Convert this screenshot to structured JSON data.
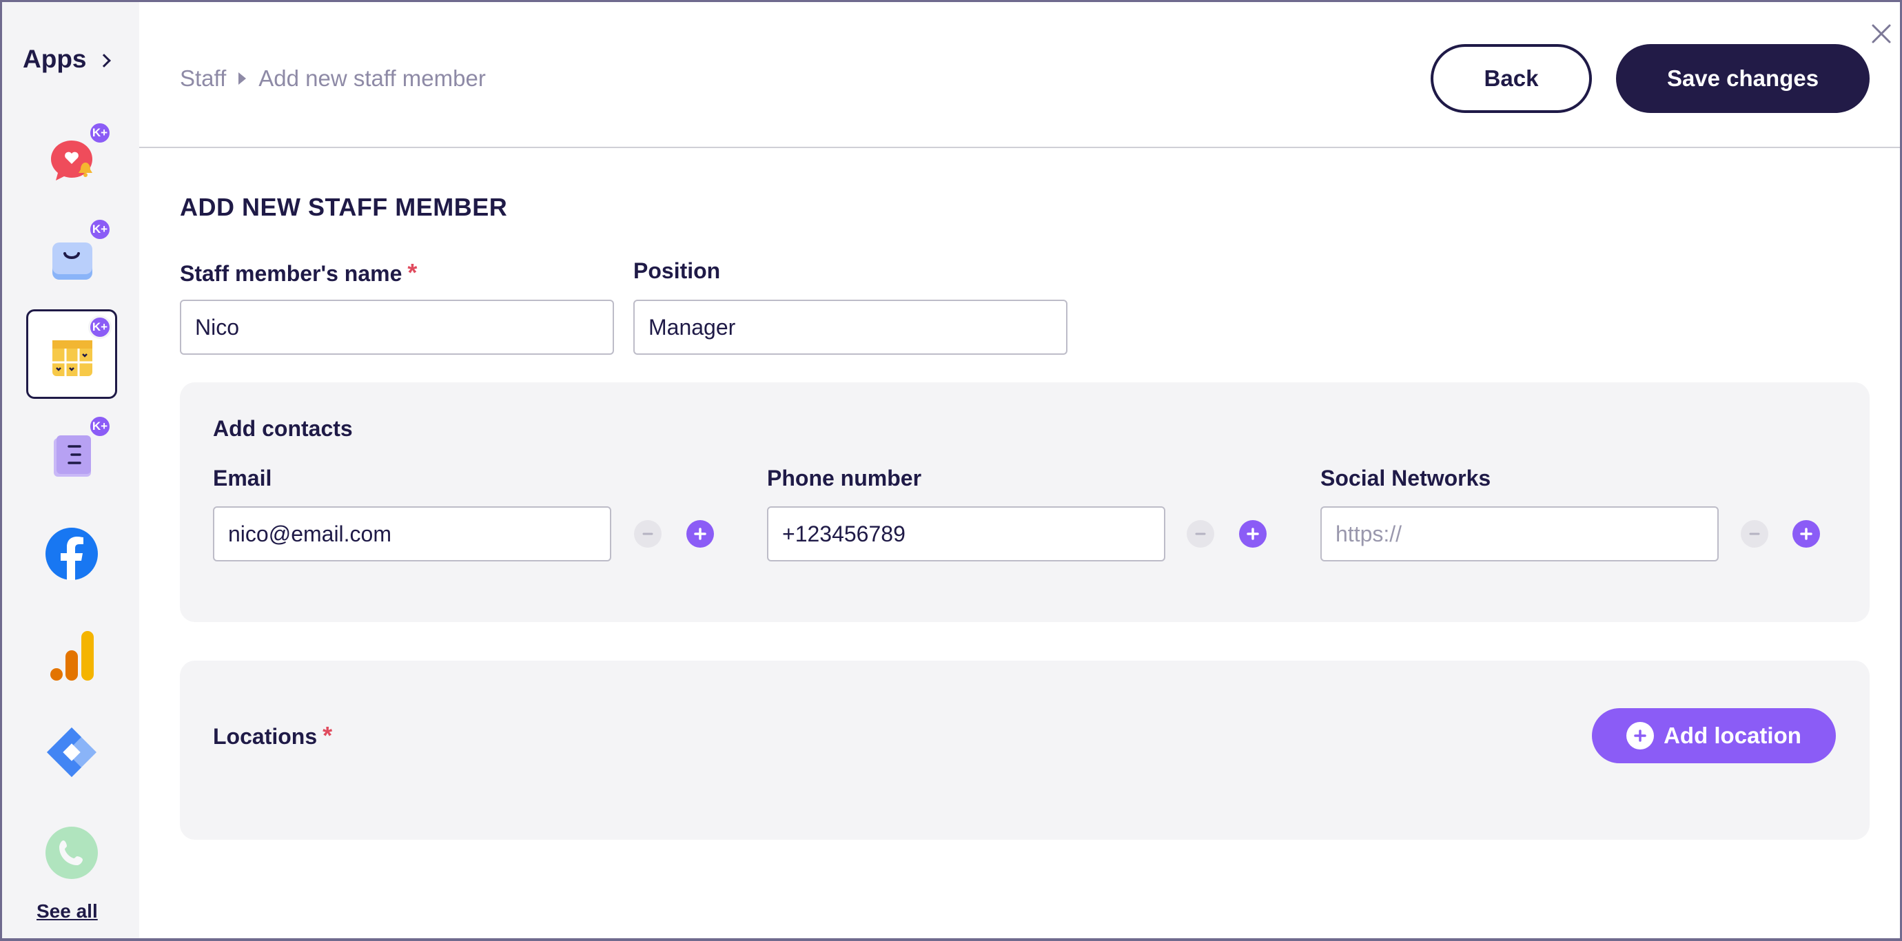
{
  "sidebar": {
    "title": "Apps",
    "items": [
      {
        "icon": "chat-heart-bell-icon",
        "badge": "K+"
      },
      {
        "icon": "shopping-bag-icon",
        "badge": "K+"
      },
      {
        "icon": "calendar-grid-icon",
        "badge": "K+",
        "active": true
      },
      {
        "icon": "document-list-icon",
        "badge": "K+"
      },
      {
        "icon": "facebook-icon"
      },
      {
        "icon": "analytics-bars-icon"
      },
      {
        "icon": "tag-manager-icon"
      },
      {
        "icon": "phone-icon"
      }
    ],
    "see_all": "See all"
  },
  "header": {
    "breadcrumb_root": "Staff",
    "breadcrumb_current": "Add new staff member",
    "back_label": "Back",
    "save_label": "Save changes"
  },
  "form": {
    "title": "ADD NEW STAFF MEMBER",
    "name_label": "Staff member's name",
    "required_mark": "*",
    "name_value": "Nico",
    "position_label": "Position",
    "position_value": "Manager"
  },
  "contacts": {
    "title": "Add contacts",
    "email_label": "Email",
    "email_value": "nico@email.com",
    "phone_label": "Phone number",
    "phone_value": "+123456789",
    "social_label": "Social Networks",
    "social_placeholder": "https://"
  },
  "locations": {
    "title": "Locations",
    "required_mark": "*",
    "add_label": "Add location"
  },
  "colors": {
    "brand_dark": "#221b47",
    "accent_purple": "#8b5cf6",
    "required_red": "#e04b5e",
    "panel_bg": "#f4f4f6"
  }
}
